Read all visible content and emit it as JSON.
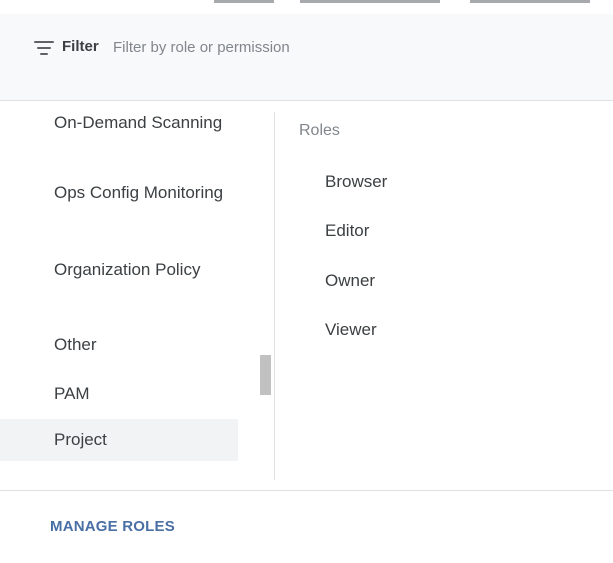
{
  "filter": {
    "label": "Filter",
    "placeholder": "Filter by role or permission",
    "icon": "filter-list-icon"
  },
  "categories": [
    {
      "label": "On-Demand Scanning"
    },
    {
      "label": "Ops Config Monitoring"
    },
    {
      "label": "Organization Policy"
    },
    {
      "label": "Other"
    },
    {
      "label": "PAM"
    },
    {
      "label": "Project",
      "selected": true
    }
  ],
  "roles": {
    "header": "Roles",
    "items": [
      "Browser",
      "Editor",
      "Owner",
      "Viewer"
    ]
  },
  "footer": {
    "manage_roles_label": "MANAGE ROLES"
  },
  "colors": {
    "accent": "#4a6fa5",
    "selected_bg": "#f1f3f4",
    "filter_bar_bg": "#f8f9fa"
  }
}
